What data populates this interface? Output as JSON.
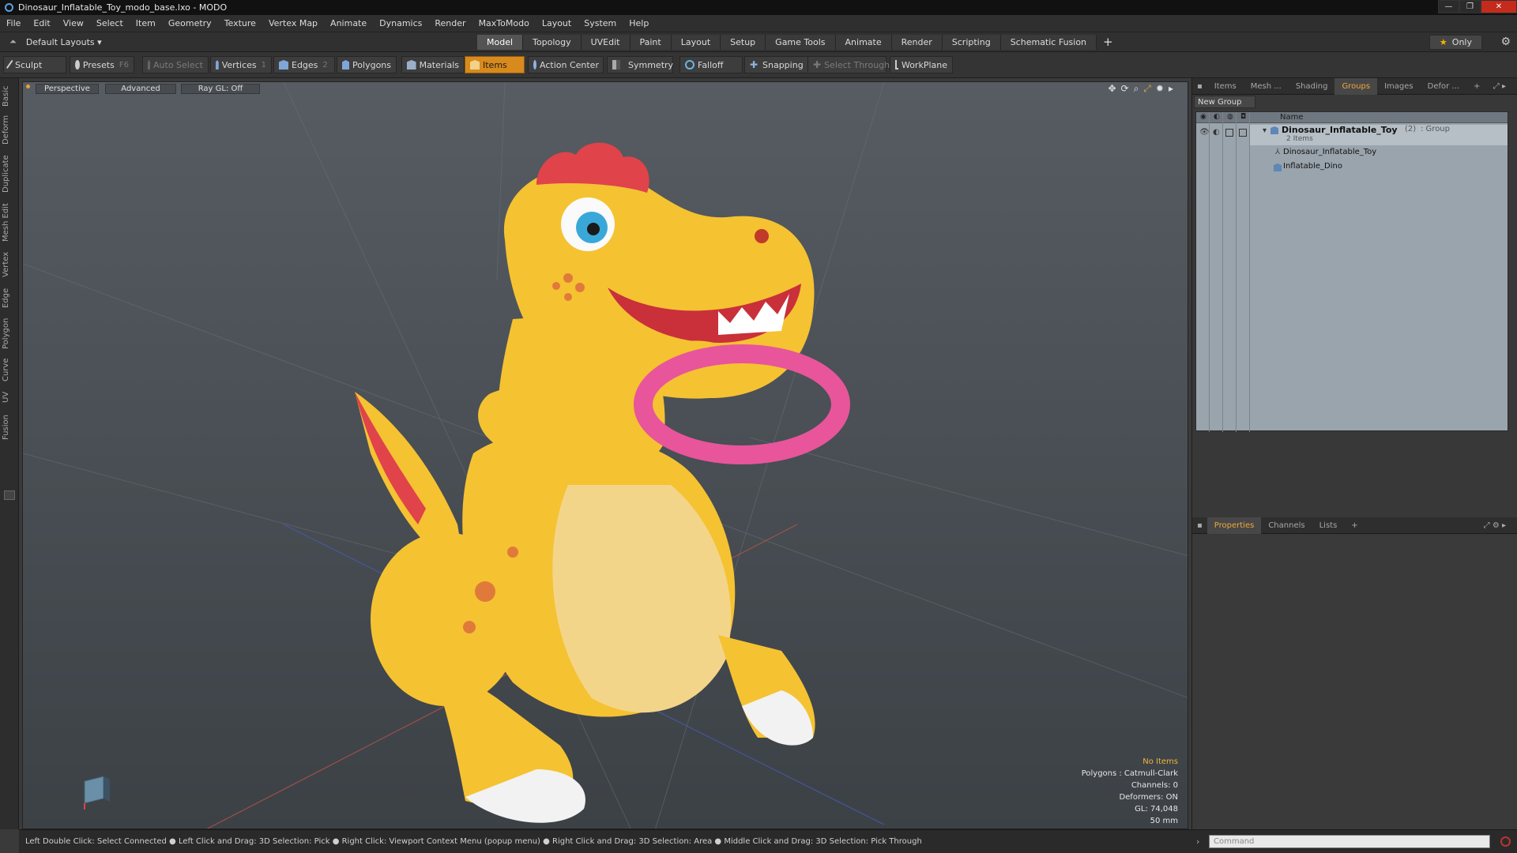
{
  "window": {
    "title": "Dinosaur_Inflatable_Toy_modo_base.lxo - MODO",
    "controls": [
      "—",
      "❐",
      "✕"
    ]
  },
  "menu": [
    "File",
    "Edit",
    "View",
    "Select",
    "Item",
    "Geometry",
    "Texture",
    "Vertex Map",
    "Animate",
    "Dynamics",
    "Render",
    "MaxToModo",
    "Layout",
    "System",
    "Help"
  ],
  "layout_selector": "Default Layouts ▾",
  "mode_tabs": [
    "Model",
    "Topology",
    "UVEdit",
    "Paint",
    "Layout",
    "Setup",
    "Game Tools",
    "Animate",
    "Render",
    "Scripting",
    "Schematic Fusion"
  ],
  "active_mode_tab": "Model",
  "only_label": "Only",
  "toolbar": {
    "sculpt": "Sculpt",
    "presets": "Presets",
    "presets_key": "F6",
    "auto_select": "Auto Select",
    "vertices": "Vertices",
    "vertices_key": "1",
    "edges": "Edges",
    "edges_key": "2",
    "polygons": "Polygons",
    "materials": "Materials",
    "items": "Items",
    "action_center": "Action Center",
    "symmetry": "Symmetry",
    "falloff": "Falloff",
    "snapping": "Snapping",
    "select_through": "Select Through",
    "workplane": "WorkPlane"
  },
  "left_tabs": [
    "Basic",
    "Deform",
    "Duplicate",
    "Mesh Edit",
    "Vertex",
    "Edge",
    "Polygon",
    "Curve",
    "UV",
    "Fusion"
  ],
  "viewport": {
    "view": "Perspective",
    "shading": "Advanced",
    "raygl": "Ray GL: Off",
    "hud": {
      "no_items": "No Items",
      "polygons": "Polygons : Catmull-Clark",
      "channels": "Channels: 0",
      "deformers": "Deformers: ON",
      "gl": "GL: 74,048",
      "scale": "50 mm"
    }
  },
  "item_panel": {
    "tabs": [
      "Items",
      "Mesh ...",
      "Shading",
      "Groups",
      "Images",
      "Defor ..."
    ],
    "active_tab": "Groups",
    "new_group": "New Group",
    "column_name": "Name",
    "group": {
      "name": "Dinosaur_Inflatable_Toy",
      "count": "(2)",
      "type": ": Group",
      "subtitle": "2 Items",
      "children": [
        "Dinosaur_Inflatable_Toy",
        "Inflatable_Dino"
      ]
    }
  },
  "props_panel": {
    "tabs": [
      "Properties",
      "Channels",
      "Lists"
    ],
    "active_tab": "Properties"
  },
  "status_hint": "Left Double Click: Select Connected ● Left Click and Drag: 3D Selection: Pick ● Right Click: Viewport Context Menu (popup menu) ● Right Click and Drag: 3D Selection: Area ● Middle Click and Drag: 3D Selection: Pick Through",
  "command_placeholder": "Command",
  "colors": {
    "accent_orange": "#f1a73a",
    "items_button": "#d98a1c",
    "dino_body": "#f5c232",
    "dino_belly": "#f3d58a",
    "dino_crest": "#e0434a",
    "ring": "#e8559b"
  }
}
